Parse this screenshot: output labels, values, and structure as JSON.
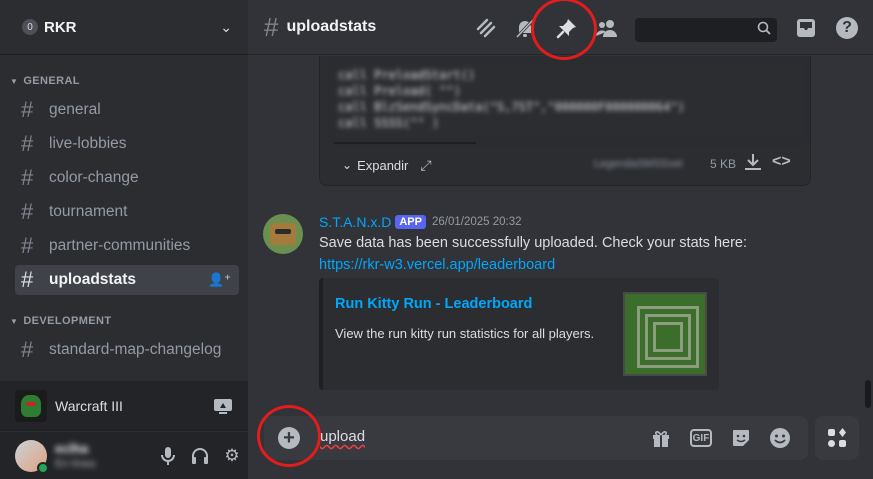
{
  "server": {
    "badge": "0",
    "name": "RKR",
    "chevron": "⌄"
  },
  "categories": {
    "general": "GENERAL",
    "development": "DEVELOPMENT"
  },
  "channels_general": [
    {
      "label": "general"
    },
    {
      "label": "live-lobbies"
    },
    {
      "label": "color-change"
    },
    {
      "label": "tournament"
    },
    {
      "label": "partner-communities"
    },
    {
      "label": "uploadstats"
    }
  ],
  "channels_development": [
    {
      "label": "standard-map-changelog"
    }
  ],
  "game": {
    "name": "Warcraft III"
  },
  "user": {
    "name": "eclha",
    "status": "En línea"
  },
  "header": {
    "channel": "uploadstats"
  },
  "attachment": {
    "code_lines": [
      "call PreloadStart()",
      "call Preload( \"\")",
      "call BlzSendSyncData(\"S,7ST\",\"000000F000000064\")",
      "call SSSS(\"\" )"
    ],
    "expand_label": "Expandir",
    "file_name": "LegendaSMSSvet",
    "file_size": "5 KB"
  },
  "message": {
    "author": "S.T.A.N.x.D",
    "badge": "APP",
    "timestamp": "26/01/2025 20:32",
    "text": "Save data has been successfully uploaded. Check your stats here:",
    "link": "https://rkr-w3.vercel.app/leaderboard",
    "embed": {
      "title": "Run Kitty Run - Leaderboard",
      "description": "View the run kitty run statistics for all players."
    }
  },
  "composer": {
    "value": "upload"
  },
  "icons": {
    "threads": "threads-icon",
    "mute": "bell-slash-icon",
    "pin": "pin-icon",
    "members": "members-icon",
    "search": "search-icon",
    "inbox": "inbox-icon",
    "help": "help-icon"
  },
  "colors": {
    "accent_link": "#00a8fc",
    "app_badge": "#5865f2",
    "annotation": "#e41c1c",
    "online": "#23a55a"
  }
}
